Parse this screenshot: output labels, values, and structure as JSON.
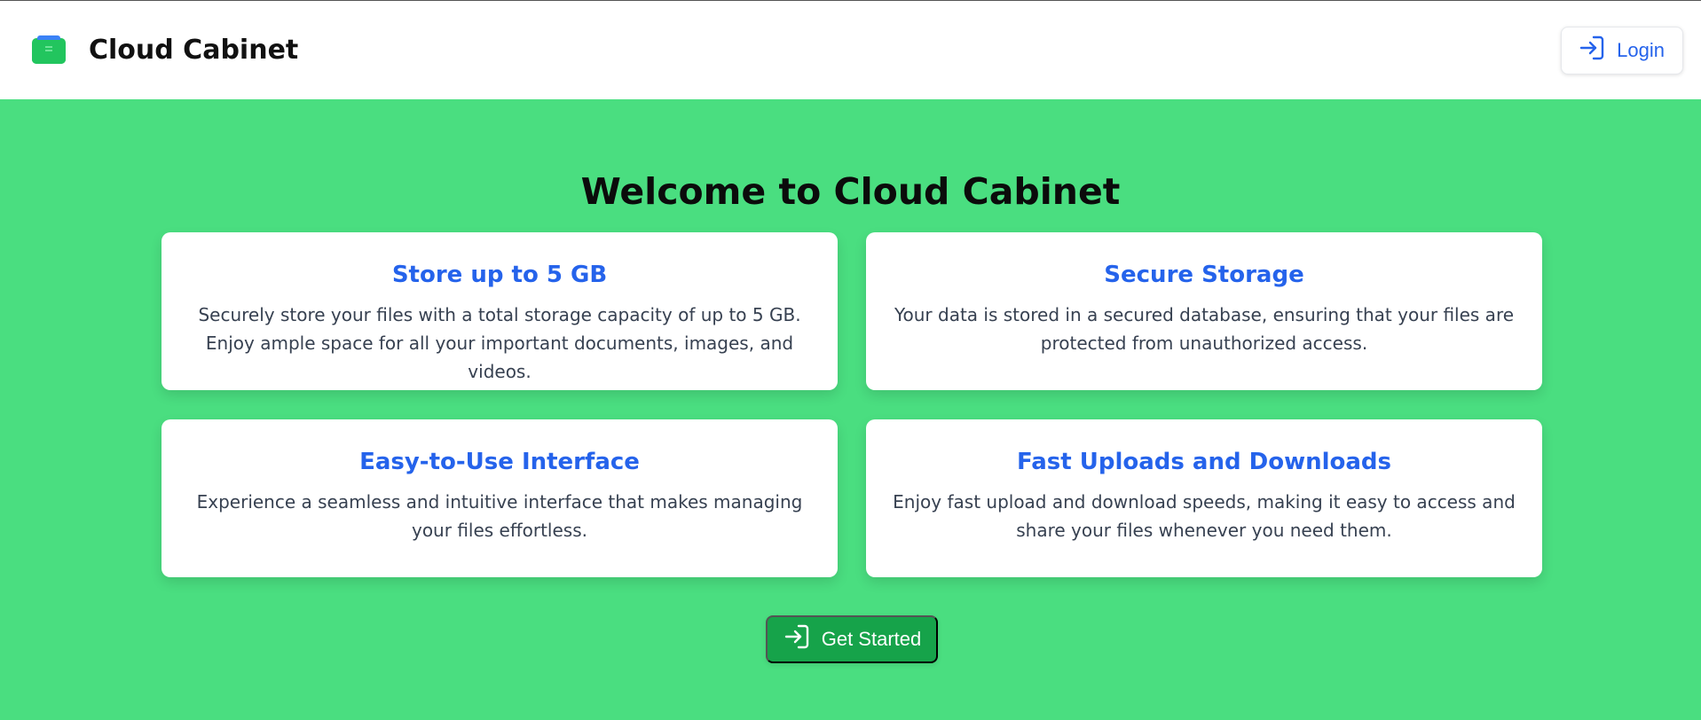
{
  "header": {
    "app_title": "Cloud Cabinet",
    "login_label": "Login",
    "logo_icon": "cabinet-icon",
    "login_icon": "sign-in-icon"
  },
  "main": {
    "welcome_title": "Welcome to Cloud Cabinet",
    "features": [
      {
        "title": "Store up to 5 GB",
        "description": "Securely store your files with a total storage capacity of up to 5 GB. Enjoy ample space for all your important documents, images, and videos."
      },
      {
        "title": "Secure Storage",
        "description": "Your data is stored in a secured database, ensuring that your files are protected from unauthorized access."
      },
      {
        "title": "Easy-to-Use Interface",
        "description": "Experience a seamless and intuitive interface that makes managing your files effortless."
      },
      {
        "title": "Fast Uploads and Downloads",
        "description": "Enjoy fast upload and download speeds, making it easy to access and share your files whenever you need them."
      }
    ],
    "cta_label": "Get Started",
    "cta_icon": "sign-in-icon"
  },
  "colors": {
    "background": "#4ade80",
    "accent_blue": "#2563eb",
    "cta_green": "#16a34a",
    "header_bg": "#ffffff"
  }
}
